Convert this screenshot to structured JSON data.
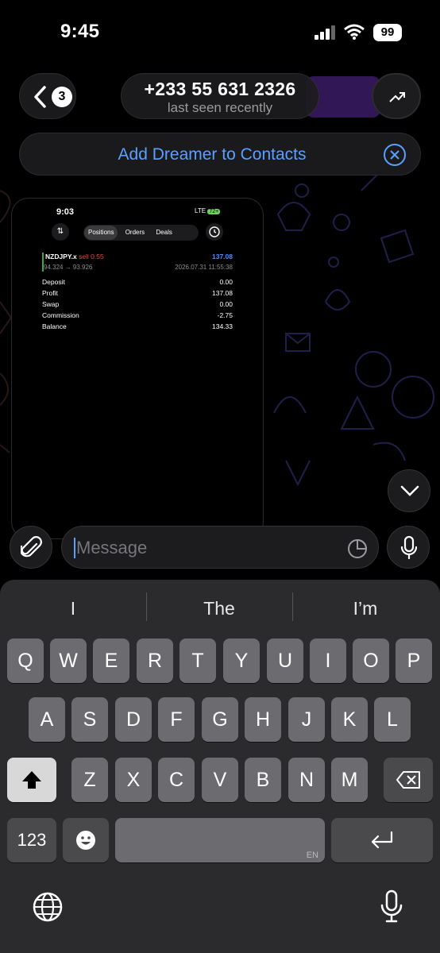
{
  "status_bar": {
    "time": "9:45",
    "battery": "99"
  },
  "header": {
    "back_count": "3",
    "contact_name": "+233 55 631 2326",
    "contact_status": "last seen recently"
  },
  "banner": {
    "label": "Add Dreamer to Contacts"
  },
  "shared_screenshot": {
    "time": "9:03",
    "network": "LTE",
    "battery": "72+",
    "tabs": [
      "Positions",
      "Orders",
      "Deals"
    ],
    "active_tab": "Positions",
    "position": {
      "symbol": "NZDJPY.x",
      "side": "sell 0.55",
      "profit": "137.08",
      "prices": "94.324 → 93.926",
      "datetime": "2026.07.31 11:55:38"
    },
    "summary": [
      {
        "label": "Deposit",
        "value": "0.00"
      },
      {
        "label": "Profit",
        "value": "137.08"
      },
      {
        "label": "Swap",
        "value": "0.00"
      },
      {
        "label": "Commission",
        "value": "-2.75"
      },
      {
        "label": "Balance",
        "value": "134.33"
      }
    ]
  },
  "composer": {
    "placeholder": "Message"
  },
  "keyboard": {
    "suggestions": [
      "I",
      "The",
      "I’m"
    ],
    "row1": [
      "Q",
      "W",
      "E",
      "R",
      "T",
      "Y",
      "U",
      "I",
      "O",
      "P"
    ],
    "row2": [
      "A",
      "S",
      "D",
      "F",
      "G",
      "H",
      "J",
      "K",
      "L"
    ],
    "row3": [
      "Z",
      "X",
      "C",
      "V",
      "B",
      "N",
      "M"
    ],
    "numbers_key": "123",
    "space_lang": "EN"
  },
  "colors": {
    "accent": "#5aa0ff",
    "profit_blue": "#4d8cff",
    "sell_red": "#e5473c"
  }
}
